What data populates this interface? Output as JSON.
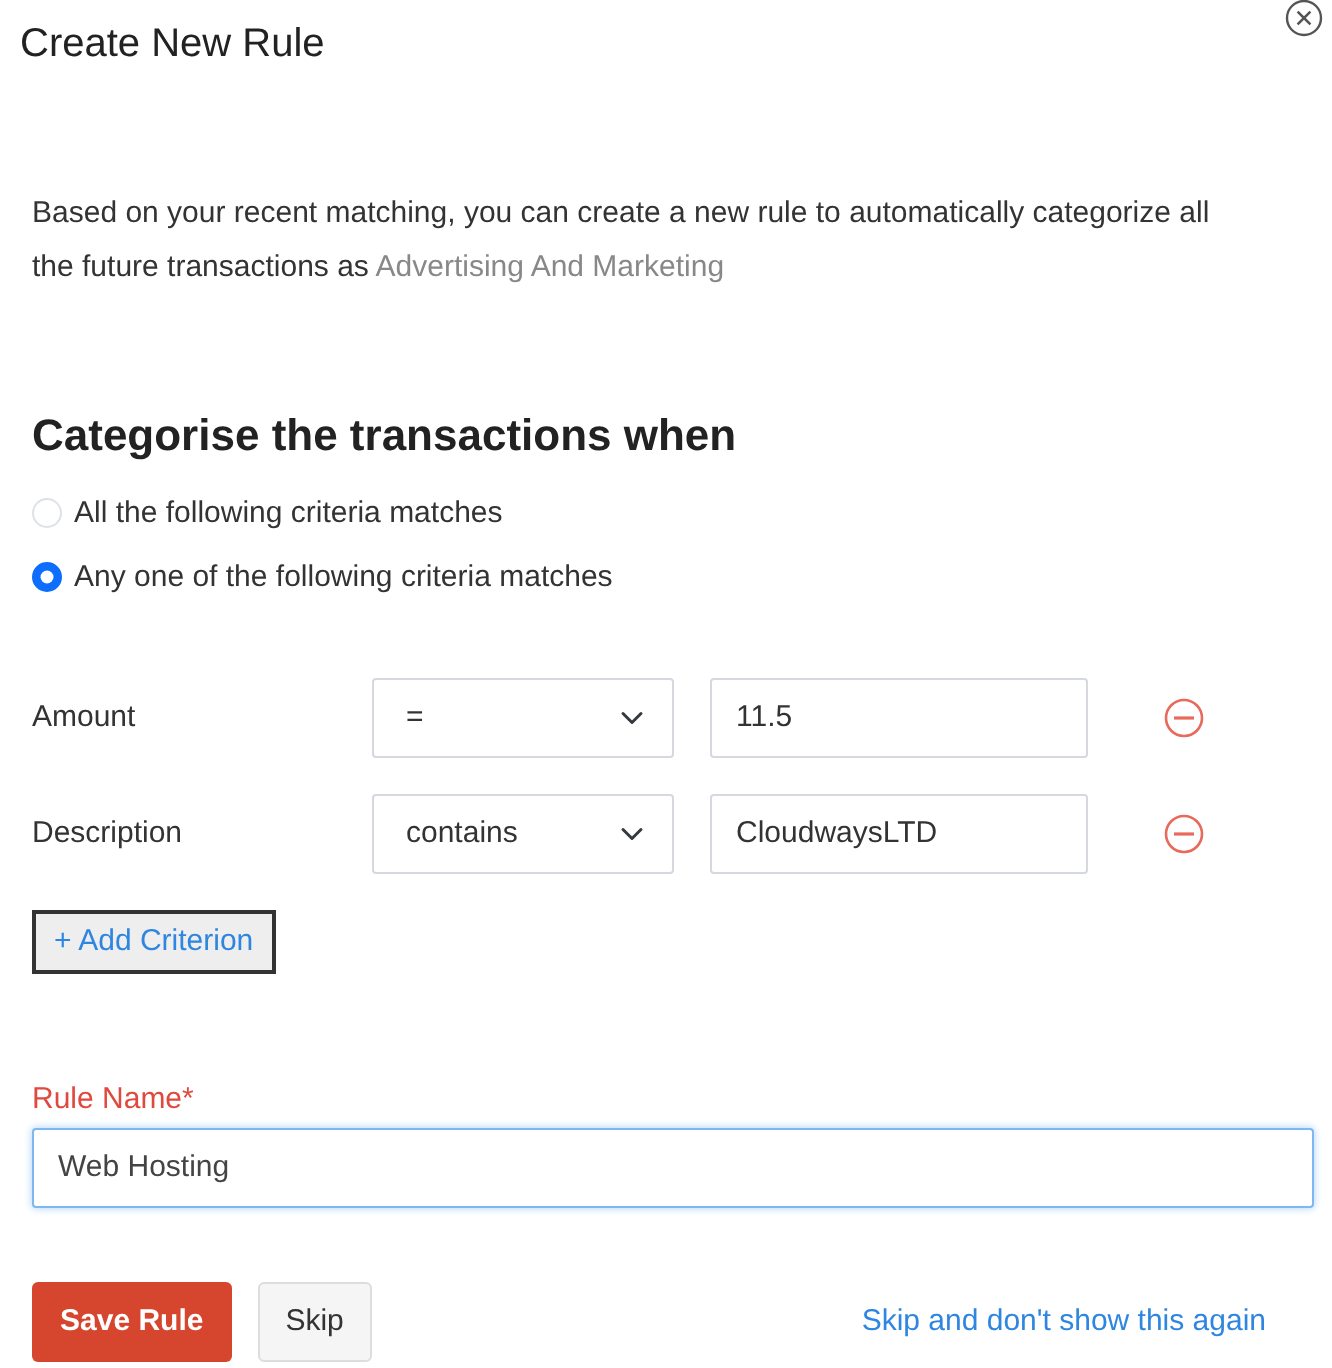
{
  "dialog": {
    "title": "Create New Rule"
  },
  "description": {
    "text": "Based on your recent matching, you can create a new rule to automatically categorize all the future transactions as",
    "category": "Advertising And Marketing"
  },
  "heading": "Categorise the transactions when",
  "match_options": [
    {
      "label": "All the following criteria matches",
      "selected": false
    },
    {
      "label": "Any one of the following criteria matches",
      "selected": true
    }
  ],
  "criteria": [
    {
      "field": "Amount",
      "operator": "=",
      "value": "11.5"
    },
    {
      "field": "Description",
      "operator": "contains",
      "value": "CloudwaysLTD"
    }
  ],
  "add_button": "+ Add Criterion",
  "rule_name": {
    "label": "Rule Name*",
    "value": "Web Hosting"
  },
  "buttons": [
    {
      "label": "Save Rule",
      "kind": "primary"
    },
    {
      "label": "Skip",
      "kind": "secondary"
    }
  ],
  "skip_link": "Skip and don't show this again"
}
